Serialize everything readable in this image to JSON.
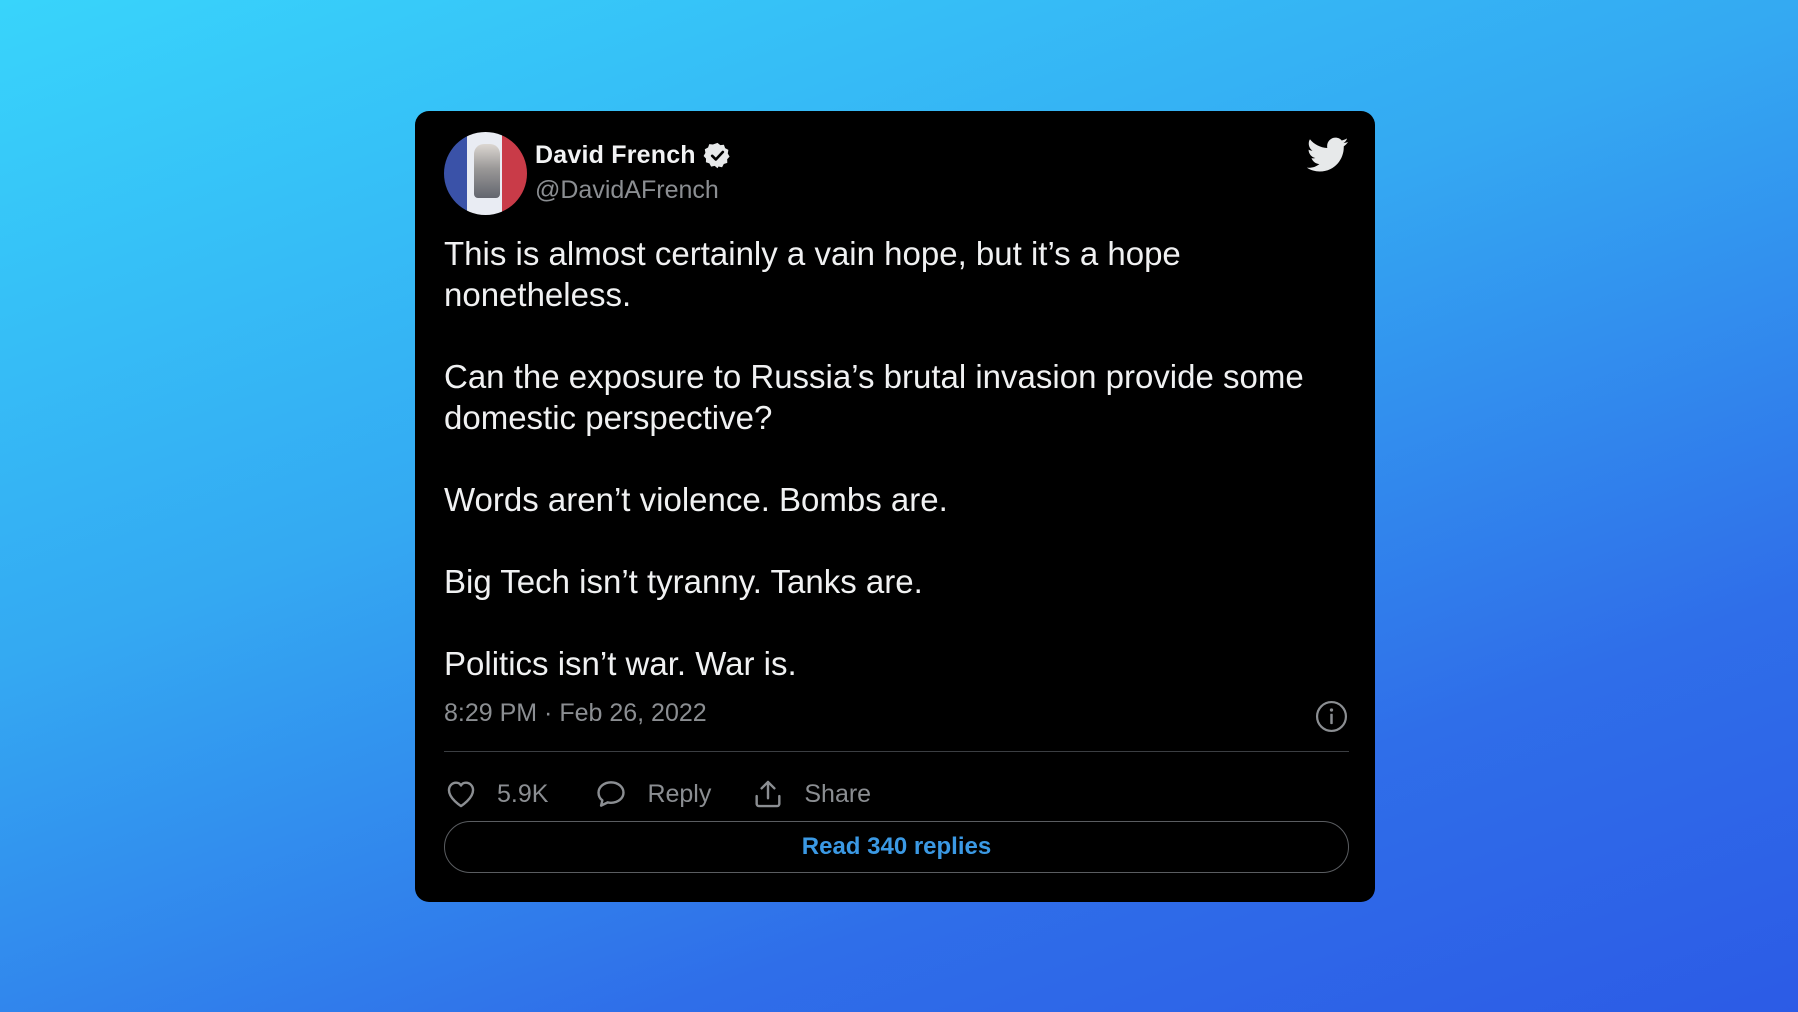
{
  "tweet": {
    "author_name": "David French",
    "author_handle": "@DavidAFrench",
    "paragraphs": [
      "This is almost certainly a vain hope, but it’s a hope nonetheless.",
      "Can the exposure to Russia’s brutal invasion provide some domestic perspective?",
      "Words aren’t violence. Bombs are.",
      "Big Tech isn’t tyranny. Tanks are.",
      "Politics isn’t war. War is."
    ],
    "timestamp": "8:29 PM · Feb 26, 2022"
  },
  "actions": {
    "like_count": "5.9K",
    "reply_label": "Reply",
    "share_label": "Share",
    "read_replies_label": "Read 340 replies"
  },
  "icons": {
    "verified": "verified-badge-icon",
    "brand": "twitter-bird-icon",
    "info": "info-icon",
    "like": "heart-icon",
    "reply": "speech-bubble-icon",
    "share": "share-upload-icon"
  },
  "colors": {
    "card_background": "#000000",
    "link_blue": "#3b99e4",
    "muted_text": "#8b8e92",
    "page_gradient_start": "#38d4fb",
    "page_gradient_end": "#2c5be6"
  }
}
